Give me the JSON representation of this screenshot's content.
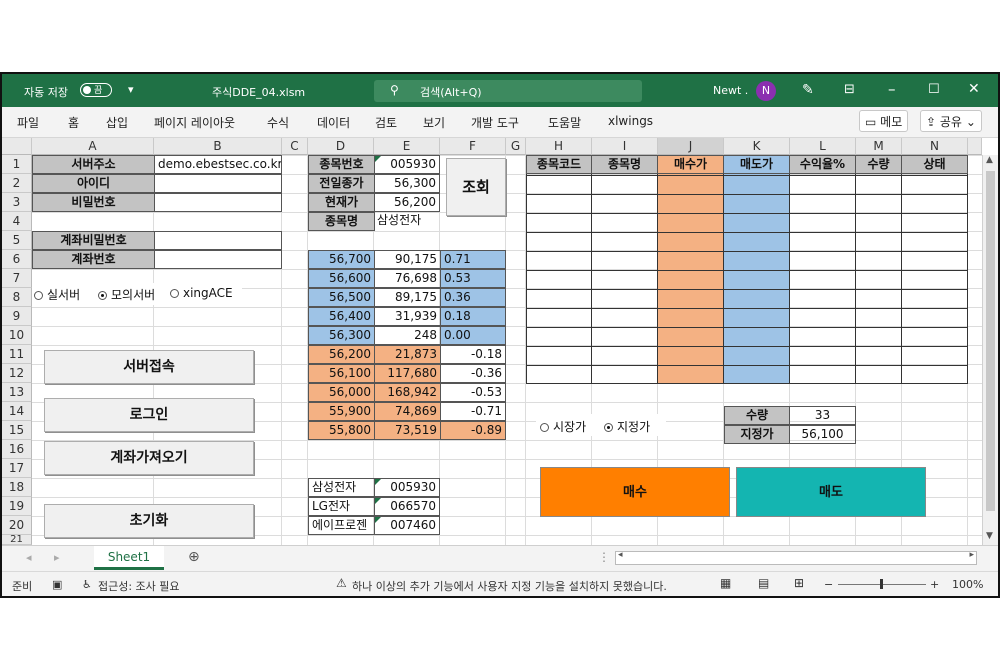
{
  "titlebar": {
    "autosave_label": "자동 저장",
    "autosave_state": "끔",
    "filename": "주식DDE_04.xlsm",
    "search_placeholder": "검색(Alt+Q)",
    "user_name": "Newt .",
    "avatar_initial": "N",
    "accent_color": "#1f7145"
  },
  "menu": {
    "items": [
      "파일",
      "홈",
      "삽입",
      "페이지 레이아웃",
      "수식",
      "데이터",
      "검토",
      "보기",
      "개발 도구",
      "도움말",
      "xlwings"
    ],
    "memo": "메모",
    "share": "공유"
  },
  "columns": [
    "A",
    "B",
    "C",
    "D",
    "E",
    "F",
    "G",
    "H",
    "I",
    "J",
    "K",
    "L",
    "M",
    "N"
  ],
  "rows": [
    "1",
    "2",
    "3",
    "4",
    "5",
    "6",
    "7",
    "8",
    "9",
    "10",
    "11",
    "12",
    "13",
    "14",
    "15",
    "16",
    "17",
    "18",
    "19",
    "20",
    "21"
  ],
  "login": {
    "server_label": "서버주소",
    "server_value": "demo.ebestsec.co.kr",
    "id_label": "아이디",
    "pw_label": "비밀번호",
    "acct_pw_label": "계좌비밀번호",
    "acct_no_label": "계좌번호"
  },
  "server_options": [
    {
      "label": "실서버",
      "selected": false
    },
    {
      "label": "모의서버",
      "selected": true
    },
    {
      "label": "xingACE",
      "selected": false
    }
  ],
  "buttons": {
    "connect": "서버접속",
    "login": "로그인",
    "accounts": "계좌가져오기",
    "reset": "초기화",
    "query": "조회",
    "buy": "매수",
    "sell": "매도"
  },
  "stock_info": {
    "code_label": "종목번호",
    "code_value": "005930",
    "prev_label": "전일종가",
    "prev_value": "56,300",
    "cur_label": "현재가",
    "cur_value": "56,200",
    "name_label": "종목명",
    "name_value": "삼성전자"
  },
  "asks": [
    [
      "56,700",
      "90,175",
      "0.71"
    ],
    [
      "56,600",
      "76,698",
      "0.53"
    ],
    [
      "56,500",
      "89,175",
      "0.36"
    ],
    [
      "56,400",
      "31,939",
      "0.18"
    ],
    [
      "56,300",
      "248",
      "0.00"
    ]
  ],
  "bids": [
    [
      "56,200",
      "21,873",
      "-0.18"
    ],
    [
      "56,100",
      "117,680",
      "-0.36"
    ],
    [
      "56,000",
      "168,942",
      "-0.53"
    ],
    [
      "55,900",
      "74,869",
      "-0.71"
    ],
    [
      "55,800",
      "73,519",
      "-0.89"
    ]
  ],
  "stock_list": [
    [
      "삼성전자",
      "005930"
    ],
    [
      "LG전자",
      "066570"
    ],
    [
      "에이프로젠",
      "007460"
    ]
  ],
  "portfolio_headers": [
    "종목코드",
    "종목명",
    "매수가",
    "매도가",
    "수익율%",
    "수량",
    "상태"
  ],
  "order_type": [
    {
      "label": "시장가",
      "selected": false
    },
    {
      "label": "지정가",
      "selected": true
    }
  ],
  "order": {
    "qty_label": "수량",
    "qty_value": "33",
    "price_label": "지정가",
    "price_value": "56,100"
  },
  "colors": {
    "ask": "#9ec3e6",
    "bid": "#f4b183",
    "buy": "#ff7f00",
    "sell": "#14b5b1"
  },
  "sheet_tab": "Sheet1",
  "status": {
    "ready": "준비",
    "accessibility": "접근성: 조사 필요",
    "message": "하나 이상의 추가 기능에서 사용자 지정 기능을 설치하지 못했습니다.",
    "zoom": "100%"
  }
}
